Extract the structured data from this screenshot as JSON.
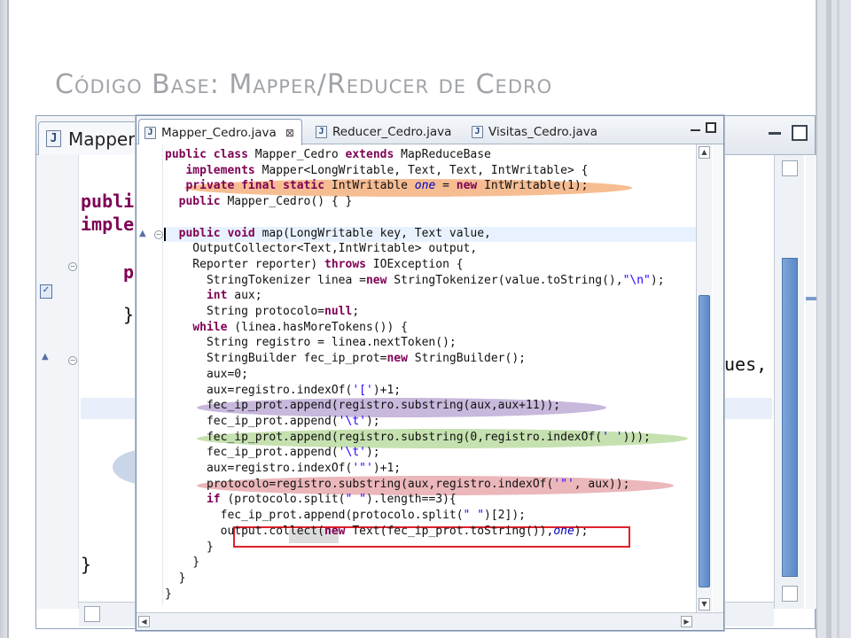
{
  "slide": {
    "title": "Código Base: Mapper/Reducer de Cedro"
  },
  "background_editor": {
    "tab_label": "Mapper",
    "code": [
      "publi",
      "imple",
      "p",
      "}",
      "ues,",
      "}"
    ]
  },
  "editor": {
    "tabs": [
      {
        "label": "Mapper_Cedro.java",
        "active": true
      },
      {
        "label": "Reducer_Cedro.java",
        "active": false
      },
      {
        "label": "Visitas_Cedro.java",
        "active": false
      }
    ],
    "tab_close_glyph": "⊠",
    "file_icon_glyph": "J",
    "code_lines": [
      "public class Mapper_Cedro extends MapReduceBase",
      "   implements Mapper<LongWritable, Text, Text, IntWritable> {",
      "   private final static IntWritable one = new IntWritable(1);",
      "  public Mapper_Cedro() { }",
      "",
      "  public void map(LongWritable key, Text value,",
      "    OutputCollector<Text,IntWritable> output,",
      "    Reporter reporter) throws IOException {",
      "      StringTokenizer linea =new StringTokenizer(value.toString(),\"\\n\");",
      "      int aux;",
      "      String protocolo=null;",
      "    while (linea.hasMoreTokens()) {",
      "      String registro = linea.nextToken();",
      "      StringBuilder fec_ip_prot=new StringBuilder();",
      "      aux=0;",
      "      aux=registro.indexOf('[')+1;",
      "      fec_ip_prot.append(registro.substring(aux,aux+11));",
      "      fec_ip_prot.append('\\t');",
      "      fec_ip_prot.append(registro.substring(0,registro.indexOf(' ')));",
      "      fec_ip_prot.append('\\t');",
      "      aux=registro.indexOf('\"')+1;",
      "      protocolo=registro.substring(aux,registro.indexOf('\"', aux));",
      "      if (protocolo.split(\" \").length==3){",
      "        fec_ip_prot.append(protocolo.split(\" \")[2]);",
      "        output.collect(new Text(fec_ip_prot.toString()),one);",
      "      }",
      "    }",
      "  }",
      "}"
    ]
  },
  "colors": {
    "highlight_orange": "#f4ab75",
    "highlight_purple": "#b7a4d2",
    "highlight_green": "#b6d99a",
    "highlight_pink": "#e5a3a7",
    "red_box": "#e0212b",
    "keyword": "#7f0055",
    "string": "#2a00ff"
  }
}
